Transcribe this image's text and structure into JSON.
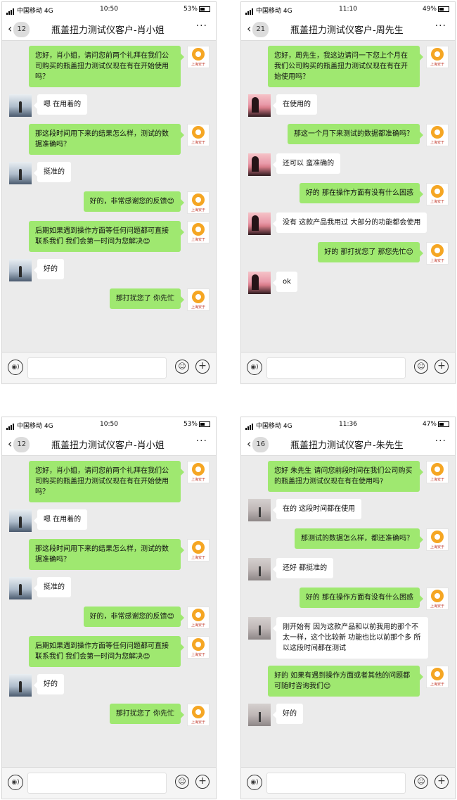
{
  "screens": [
    {
      "status": {
        "carrier": "中国移动 4G",
        "time": "10:50",
        "battery": "53%"
      },
      "nav": {
        "back": "‹",
        "unread": "12",
        "title": "瓶盖扭力测试仪客户-肖小姐",
        "more": "···"
      },
      "avatar_caption": "上海安于",
      "avatar_style": "a",
      "messages": [
        {
          "from": "me",
          "text": "您好，肖小姐，请问您前两个礼拜在我们公司购买的瓶盖扭力测试仪现在有在开始使用吗？"
        },
        {
          "from": "customer",
          "text": "嗯 在用着的"
        },
        {
          "from": "me",
          "text": "那这段时间用下来的结果怎么样，测试的数据准确吗？"
        },
        {
          "from": "customer",
          "text": "挺准的"
        },
        {
          "from": "me",
          "text": "好的，非常感谢您的反馈😊"
        },
        {
          "from": "me",
          "text": "后期如果遇到操作方面等任何问题都可直接联系我们 我们会第一时间为您解决😊"
        },
        {
          "from": "customer",
          "text": "好的"
        },
        {
          "from": "me",
          "text": "那打扰您了 你先忙"
        }
      ]
    },
    {
      "status": {
        "carrier": "中国移动 4G",
        "time": "11:10",
        "battery": "49%"
      },
      "nav": {
        "back": "‹",
        "unread": "21",
        "title": "瓶盖扭力测试仪客户-周先生",
        "more": "···"
      },
      "avatar_caption": "上海安于",
      "avatar_style": "b",
      "messages": [
        {
          "from": "me",
          "text": "您好，周先生，我这边请问一下您上个月在我们公司购买的瓶盖扭力测试仪现在有在开始使用吗？"
        },
        {
          "from": "customer",
          "text": "在使用的"
        },
        {
          "from": "me",
          "text": "那这一个月下来测试的数据都准确吗？"
        },
        {
          "from": "customer",
          "text": "还可以 蛮准确的"
        },
        {
          "from": "me",
          "text": "好的 那在操作方面有没有什么困惑"
        },
        {
          "from": "customer",
          "text": "没有 这款产品我用过 大部分的功能都会使用"
        },
        {
          "from": "me",
          "text": "好的 那打扰您了 那您先忙😊"
        },
        {
          "from": "customer",
          "text": "ok"
        }
      ]
    },
    {
      "status": {
        "carrier": "中国移动 4G",
        "time": "10:50",
        "battery": "53%"
      },
      "nav": {
        "back": "‹",
        "unread": "12",
        "title": "瓶盖扭力测试仪客户-肖小姐",
        "more": "···"
      },
      "avatar_caption": "上海安于",
      "avatar_style": "a",
      "messages": [
        {
          "from": "me",
          "text": "您好，肖小姐，请问您前两个礼拜在我们公司购买的瓶盖扭力测试仪现在有在开始使用吗？"
        },
        {
          "from": "customer",
          "text": "嗯 在用着的"
        },
        {
          "from": "me",
          "text": "那这段时间用下来的结果怎么样，测试的数据准确吗？"
        },
        {
          "from": "customer",
          "text": "挺准的"
        },
        {
          "from": "me",
          "text": "好的，非常感谢您的反馈😊"
        },
        {
          "from": "me",
          "text": "后期如果遇到操作方面等任何问题都可直接联系我们 我们会第一时间为您解决😊"
        },
        {
          "from": "customer",
          "text": "好的"
        },
        {
          "from": "me",
          "text": "那打扰您了 你先忙"
        }
      ]
    },
    {
      "status": {
        "carrier": "中国移动 4G",
        "time": "11:36",
        "battery": "47%"
      },
      "nav": {
        "back": "‹",
        "unread": "16",
        "title": "瓶盖扭力测试仪客户-朱先生",
        "more": "···"
      },
      "avatar_caption": "上海安于",
      "avatar_style": "c",
      "messages": [
        {
          "from": "me",
          "text": "您好 朱先生 请问您前段时间在我们公司购买的瓶盖扭力测试仪现在有在使用吗?"
        },
        {
          "from": "customer",
          "text": "在的 这段时间都在使用"
        },
        {
          "from": "me",
          "text": "那测试的数据怎么样，都还准确吗？"
        },
        {
          "from": "customer",
          "text": "还好 都挺准的"
        },
        {
          "from": "me",
          "text": "好的 那在操作方面有没有什么困惑"
        },
        {
          "from": "customer",
          "text": "刚开始有 因为这款产品和以前我用的那个不太一样，这个比较新 功能也比以前那个多 所以这段时间都在测试"
        },
        {
          "from": "me",
          "text": "好的 如果有遇到操作方面或者其他的问题都可随时咨询我们😊"
        },
        {
          "from": "customer",
          "text": "好的"
        }
      ]
    }
  ]
}
